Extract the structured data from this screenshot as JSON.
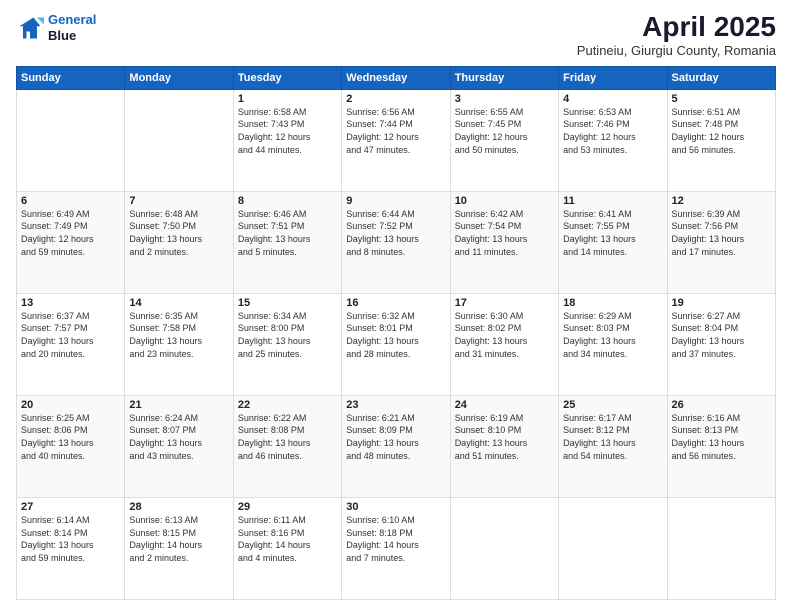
{
  "logo": {
    "line1": "General",
    "line2": "Blue"
  },
  "title": "April 2025",
  "subtitle": "Putineiu, Giurgiu County, Romania",
  "days_header": [
    "Sunday",
    "Monday",
    "Tuesday",
    "Wednesday",
    "Thursday",
    "Friday",
    "Saturday"
  ],
  "weeks": [
    [
      {
        "num": "",
        "info": ""
      },
      {
        "num": "",
        "info": ""
      },
      {
        "num": "1",
        "info": "Sunrise: 6:58 AM\nSunset: 7:43 PM\nDaylight: 12 hours\nand 44 minutes."
      },
      {
        "num": "2",
        "info": "Sunrise: 6:56 AM\nSunset: 7:44 PM\nDaylight: 12 hours\nand 47 minutes."
      },
      {
        "num": "3",
        "info": "Sunrise: 6:55 AM\nSunset: 7:45 PM\nDaylight: 12 hours\nand 50 minutes."
      },
      {
        "num": "4",
        "info": "Sunrise: 6:53 AM\nSunset: 7:46 PM\nDaylight: 12 hours\nand 53 minutes."
      },
      {
        "num": "5",
        "info": "Sunrise: 6:51 AM\nSunset: 7:48 PM\nDaylight: 12 hours\nand 56 minutes."
      }
    ],
    [
      {
        "num": "6",
        "info": "Sunrise: 6:49 AM\nSunset: 7:49 PM\nDaylight: 12 hours\nand 59 minutes."
      },
      {
        "num": "7",
        "info": "Sunrise: 6:48 AM\nSunset: 7:50 PM\nDaylight: 13 hours\nand 2 minutes."
      },
      {
        "num": "8",
        "info": "Sunrise: 6:46 AM\nSunset: 7:51 PM\nDaylight: 13 hours\nand 5 minutes."
      },
      {
        "num": "9",
        "info": "Sunrise: 6:44 AM\nSunset: 7:52 PM\nDaylight: 13 hours\nand 8 minutes."
      },
      {
        "num": "10",
        "info": "Sunrise: 6:42 AM\nSunset: 7:54 PM\nDaylight: 13 hours\nand 11 minutes."
      },
      {
        "num": "11",
        "info": "Sunrise: 6:41 AM\nSunset: 7:55 PM\nDaylight: 13 hours\nand 14 minutes."
      },
      {
        "num": "12",
        "info": "Sunrise: 6:39 AM\nSunset: 7:56 PM\nDaylight: 13 hours\nand 17 minutes."
      }
    ],
    [
      {
        "num": "13",
        "info": "Sunrise: 6:37 AM\nSunset: 7:57 PM\nDaylight: 13 hours\nand 20 minutes."
      },
      {
        "num": "14",
        "info": "Sunrise: 6:35 AM\nSunset: 7:58 PM\nDaylight: 13 hours\nand 23 minutes."
      },
      {
        "num": "15",
        "info": "Sunrise: 6:34 AM\nSunset: 8:00 PM\nDaylight: 13 hours\nand 25 minutes."
      },
      {
        "num": "16",
        "info": "Sunrise: 6:32 AM\nSunset: 8:01 PM\nDaylight: 13 hours\nand 28 minutes."
      },
      {
        "num": "17",
        "info": "Sunrise: 6:30 AM\nSunset: 8:02 PM\nDaylight: 13 hours\nand 31 minutes."
      },
      {
        "num": "18",
        "info": "Sunrise: 6:29 AM\nSunset: 8:03 PM\nDaylight: 13 hours\nand 34 minutes."
      },
      {
        "num": "19",
        "info": "Sunrise: 6:27 AM\nSunset: 8:04 PM\nDaylight: 13 hours\nand 37 minutes."
      }
    ],
    [
      {
        "num": "20",
        "info": "Sunrise: 6:25 AM\nSunset: 8:06 PM\nDaylight: 13 hours\nand 40 minutes."
      },
      {
        "num": "21",
        "info": "Sunrise: 6:24 AM\nSunset: 8:07 PM\nDaylight: 13 hours\nand 43 minutes."
      },
      {
        "num": "22",
        "info": "Sunrise: 6:22 AM\nSunset: 8:08 PM\nDaylight: 13 hours\nand 46 minutes."
      },
      {
        "num": "23",
        "info": "Sunrise: 6:21 AM\nSunset: 8:09 PM\nDaylight: 13 hours\nand 48 minutes."
      },
      {
        "num": "24",
        "info": "Sunrise: 6:19 AM\nSunset: 8:10 PM\nDaylight: 13 hours\nand 51 minutes."
      },
      {
        "num": "25",
        "info": "Sunrise: 6:17 AM\nSunset: 8:12 PM\nDaylight: 13 hours\nand 54 minutes."
      },
      {
        "num": "26",
        "info": "Sunrise: 6:16 AM\nSunset: 8:13 PM\nDaylight: 13 hours\nand 56 minutes."
      }
    ],
    [
      {
        "num": "27",
        "info": "Sunrise: 6:14 AM\nSunset: 8:14 PM\nDaylight: 13 hours\nand 59 minutes."
      },
      {
        "num": "28",
        "info": "Sunrise: 6:13 AM\nSunset: 8:15 PM\nDaylight: 14 hours\nand 2 minutes."
      },
      {
        "num": "29",
        "info": "Sunrise: 6:11 AM\nSunset: 8:16 PM\nDaylight: 14 hours\nand 4 minutes."
      },
      {
        "num": "30",
        "info": "Sunrise: 6:10 AM\nSunset: 8:18 PM\nDaylight: 14 hours\nand 7 minutes."
      },
      {
        "num": "",
        "info": ""
      },
      {
        "num": "",
        "info": ""
      },
      {
        "num": "",
        "info": ""
      }
    ]
  ]
}
